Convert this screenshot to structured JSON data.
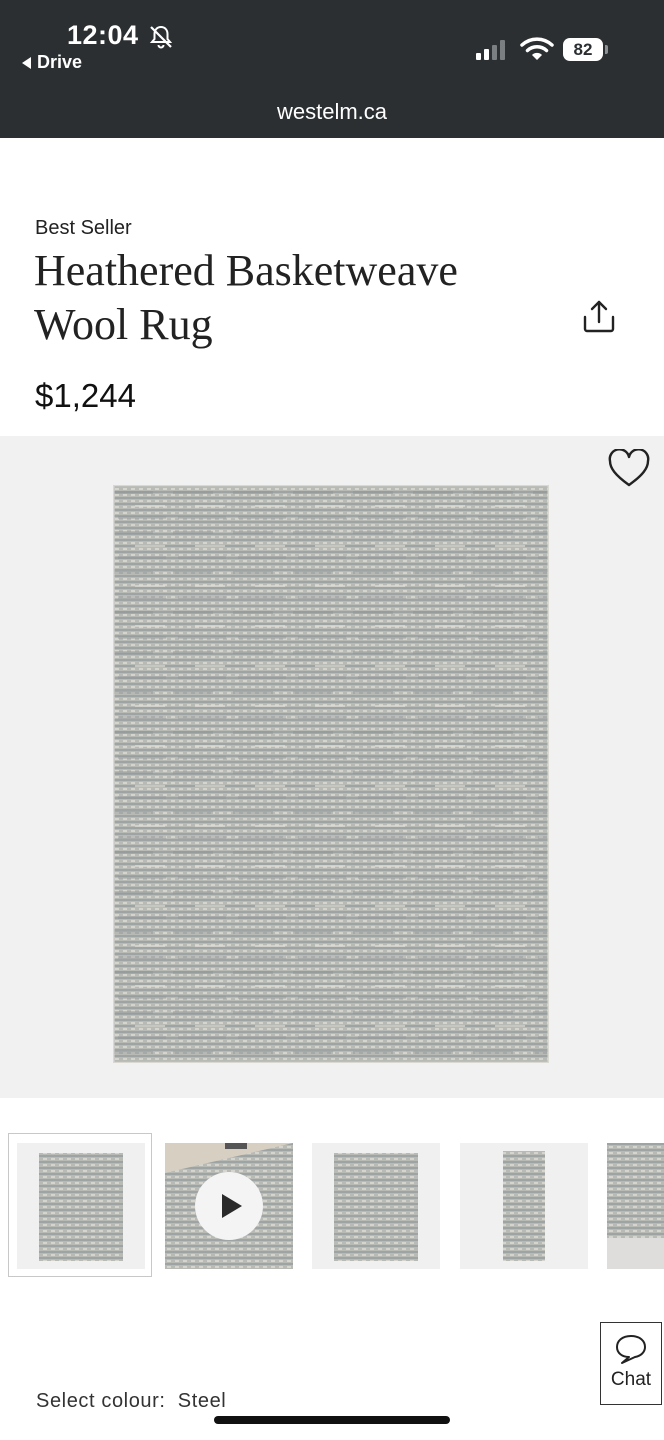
{
  "status_bar": {
    "time": "12:04",
    "back_app": "Drive",
    "battery": "82"
  },
  "browser": {
    "url": "westelm.ca"
  },
  "product": {
    "badge": "Best Seller",
    "title": "Heathered Basketweave Wool Rug",
    "price": "$1,244"
  },
  "gallery": {
    "thumbnails": [
      "rug-front",
      "video",
      "rug-front-alt",
      "runner",
      "detail"
    ]
  },
  "chat": {
    "label": "Chat"
  },
  "colour": {
    "label": "Select colour:",
    "value": "Steel"
  },
  "colors": {
    "top_bar": "#2b2f31",
    "rug": "#b4b6b3"
  }
}
